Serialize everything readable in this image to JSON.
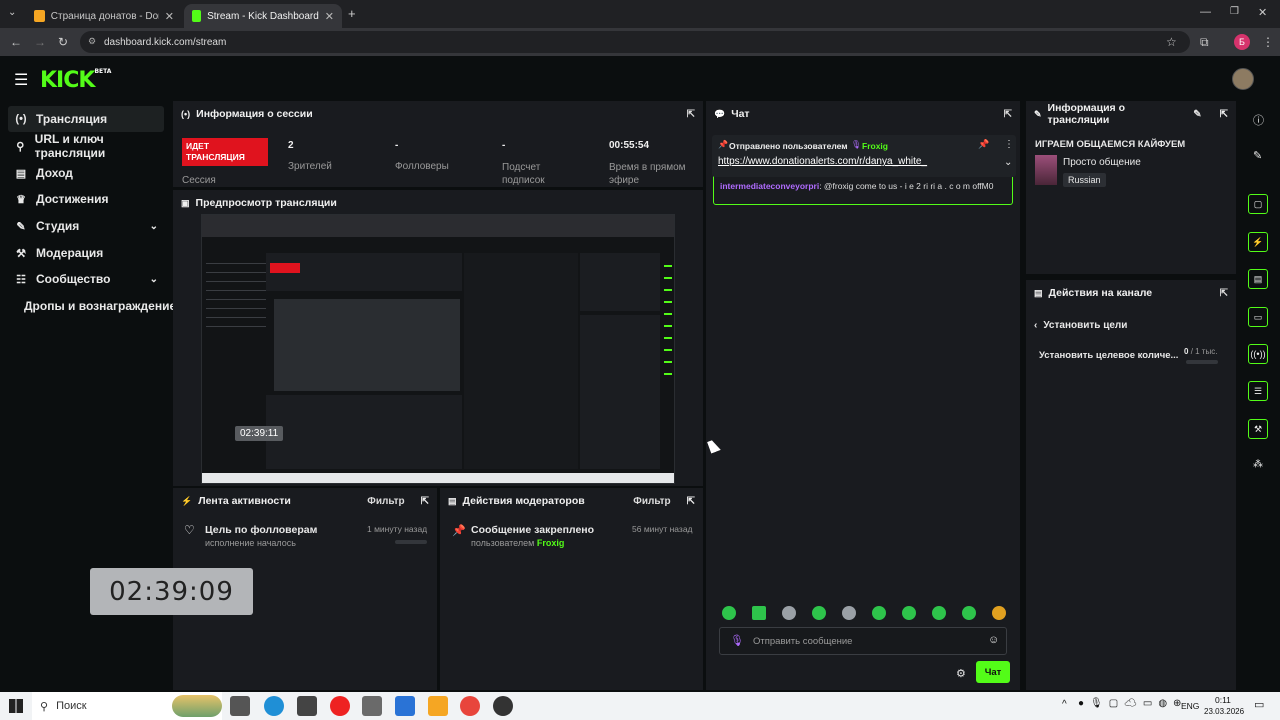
{
  "browser": {
    "tabs": [
      {
        "title": "Страница донатов - Donation"
      },
      {
        "title": "Stream - Kick Dashboard"
      }
    ],
    "url": "dashboard.kick.com/stream",
    "profile_initial": "Б"
  },
  "kick": {
    "logo": "KICK",
    "logo_badge": "BETA"
  },
  "sidebar": {
    "items": [
      {
        "label": "Трансляция",
        "icon": "broadcast-icon"
      },
      {
        "label": "URL и ключ трансляции",
        "icon": "key-icon"
      },
      {
        "label": "Доход",
        "icon": "revenue-icon"
      },
      {
        "label": "Достижения",
        "icon": "trophy-icon"
      },
      {
        "label": "Студия",
        "icon": "studio-icon"
      },
      {
        "label": "Модерация",
        "icon": "shield-icon"
      },
      {
        "label": "Сообщество",
        "icon": "community-icon"
      },
      {
        "label": "Дропы и вознаграждение",
        "icon": ""
      }
    ]
  },
  "session": {
    "title": "Информация о сессии",
    "live_badge": "ИДЕТ ТРАНСЛЯЦИЯ",
    "live_sub": "Сессия",
    "stats": [
      {
        "value": "2",
        "label": "Зрителей"
      },
      {
        "value": "-",
        "label": "Фолловеры"
      },
      {
        "value": "-",
        "label": "Подсчет подписок"
      },
      {
        "value": "00:55:54",
        "label": "Время в прямом эфире"
      }
    ]
  },
  "preview": {
    "title": "Предпросмотр трансляции",
    "timer": "02:39:11"
  },
  "overlay_timer": "02:39:09",
  "activity": {
    "title": "Лента активности",
    "filter": "Фильтр",
    "item_title": "Цель по фолловерам",
    "item_sub": "исполнение началось",
    "item_time": "1 минуту назад"
  },
  "modactions": {
    "title": "Действия модераторов",
    "filter": "Фильтр",
    "item_title": "Сообщение закреплено",
    "item_sub": "пользователем",
    "item_user": "Froxig",
    "item_time": "56 минут назад"
  },
  "chat": {
    "title": "Чат",
    "pinned_by": "Отправлено пользователем",
    "pinned_user": "Froxig",
    "pinned_link": "https://www.donationalerts.com/r/danya_white_",
    "msg_user": "intermediateconveyorpri",
    "msg_text": ": @froxig come to us - i e 2 ri ri a . c o m offM0",
    "input_placeholder": "Отправить сообщение",
    "send_label": "Чат"
  },
  "stream_info": {
    "title": "Информация о трансляции",
    "stream_title": "ИГРАЕМ ОБЩАЕМСЯ КАЙФУЕМ",
    "category": "Просто общение",
    "language": "Russian"
  },
  "channel_actions": {
    "title": "Действия на канале",
    "back_label": "Установить цели",
    "goal_label": "Установить целевое количе...",
    "goal_progress": "0",
    "goal_target": "/ 1 тыс."
  },
  "taskbar": {
    "search": "Поиск",
    "lang": "ENG",
    "time": "0:11",
    "date": "23.03.2026"
  },
  "colors": {
    "accent": "#53fc18",
    "live": "#e0131e",
    "panel": "#191b1f",
    "bg": "#0b0e0f",
    "purple": "#b06cff"
  }
}
